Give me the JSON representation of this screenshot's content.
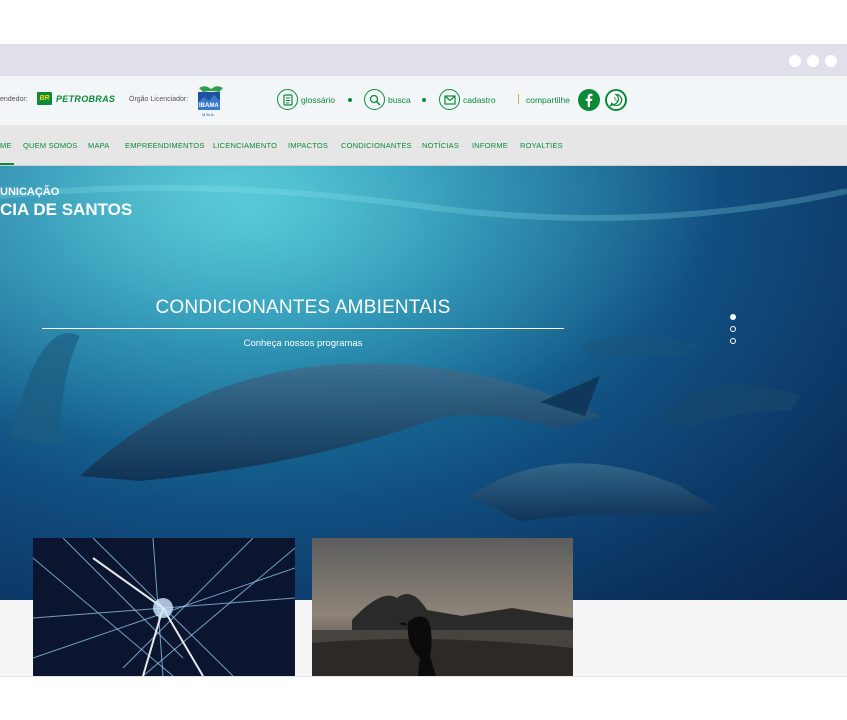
{
  "window": {
    "controls": [
      "dot",
      "dot",
      "dot"
    ]
  },
  "header": {
    "empreendedor_label": "endedor:",
    "empreendedor_logo_text": "PETROBRAS",
    "empreendedor_logo_badge": "BR",
    "orgao_label": "Órgão Licenciador:",
    "orgao_logo_text": "IBAMA",
    "orgao_logo_sub": "M.M.A.",
    "utilities": [
      {
        "label": "glossário",
        "icon": "document-icon"
      },
      {
        "label": "busca",
        "icon": "search-icon"
      },
      {
        "label": "cadastro",
        "icon": "mail-icon"
      }
    ],
    "share_label": "compartilhe",
    "social": [
      {
        "icon": "facebook-icon",
        "color": "#0b8a3a"
      },
      {
        "icon": "whatsapp-icon",
        "color": "#0b8a3a"
      }
    ]
  },
  "nav": {
    "items": [
      "ME",
      "QUEM SOMOS",
      "MAPA",
      "EMPREENDIMENTOS",
      "LICENCIAMENTO",
      "IMPACTOS",
      "CONDICIONANTES",
      "NOTÍCIAS",
      "INFORME",
      "ROYALTIES"
    ]
  },
  "hero": {
    "brand_line1": "UNICAÇÃO",
    "brand_line2": "CIA DE SANTOS",
    "title": "CONDICIONANTES AMBIENTAIS",
    "subtitle": "Conheça nossos programas",
    "slides_total": 3,
    "active_slide": 1
  },
  "colors": {
    "brand_green": "#0b8a3a",
    "nav_bg": "#e6e6e6",
    "header_bg": "#f3f6f8"
  }
}
